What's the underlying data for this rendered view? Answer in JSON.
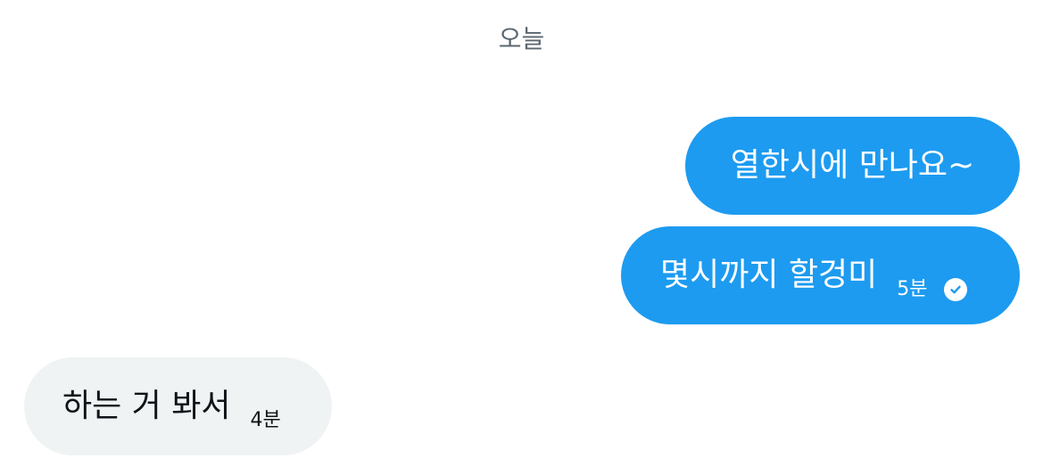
{
  "conversation": {
    "date_separator": "오늘",
    "messages": [
      {
        "direction": "sent",
        "text": "열한시에 만나요~",
        "time": ""
      },
      {
        "direction": "sent",
        "text": "몇시까지 할겅미",
        "time": "5분",
        "status_icon": "check-circle-icon"
      },
      {
        "direction": "received",
        "text": "하는 거 봐서",
        "time": "4분"
      }
    ]
  },
  "colors": {
    "sent_bubble": "#1d9bf0",
    "received_bubble": "#eff3f4",
    "date_text": "#5b6670"
  }
}
